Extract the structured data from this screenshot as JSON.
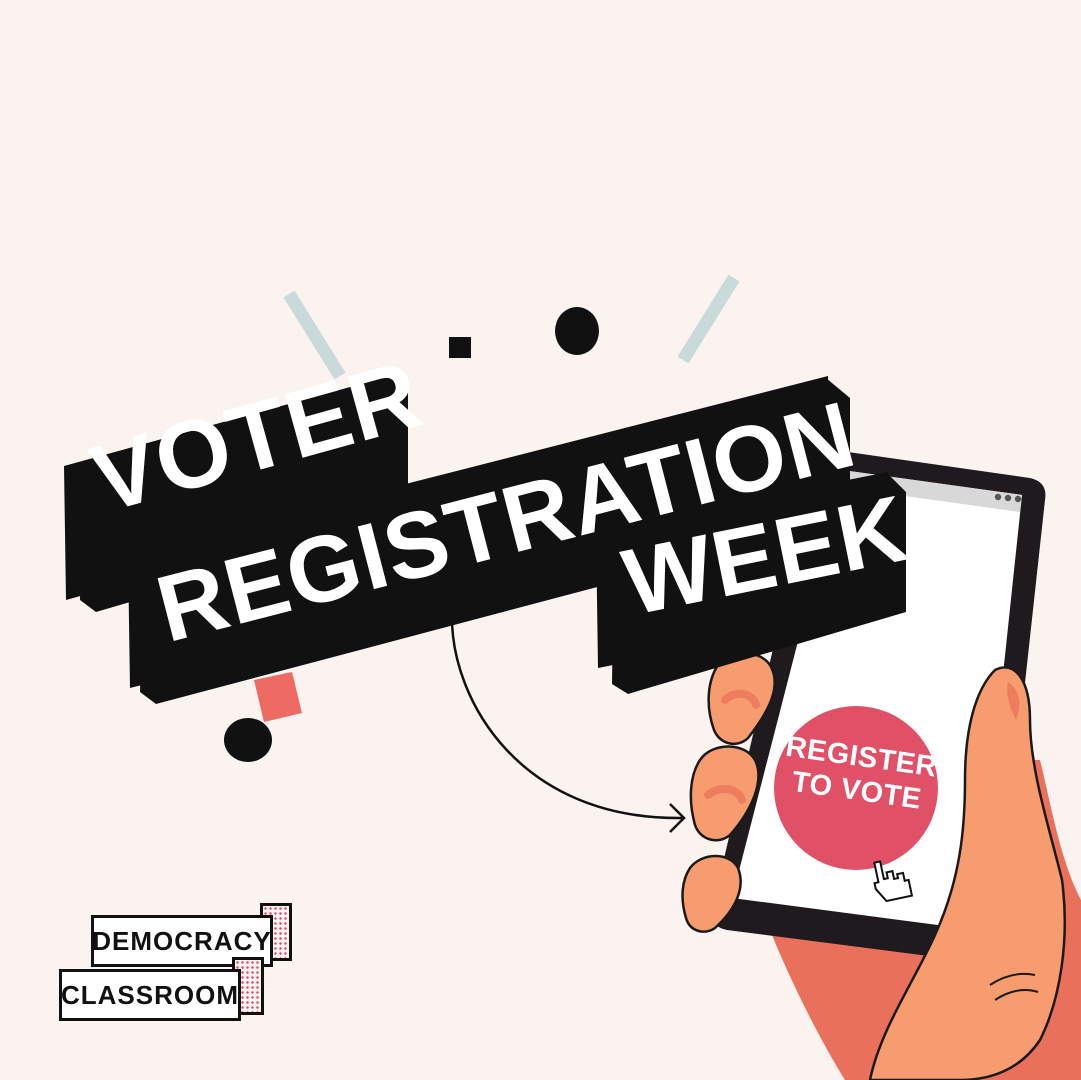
{
  "headline": {
    "line1": "VOTER",
    "line2": "REGISTRATION",
    "line3": "WEEK"
  },
  "phone": {
    "button_label_line1": "REGISTER",
    "button_label_line2": "TO VOTE"
  },
  "logo": {
    "line1": "DEMOCRACY",
    "line2": "CLASSROOM"
  },
  "colors": {
    "background": "#fbf3f0",
    "black": "#111111",
    "button_red": "#e05168",
    "hand": "#f79c6e",
    "hand_shadow": "#e9705a",
    "accent_blue": "#c9dadb",
    "accent_coral": "#ee6b63",
    "logo_dots": "#e0567a"
  },
  "icons": [
    "cursor-hand-icon",
    "arrow-icon",
    "menu-dots-icon"
  ]
}
